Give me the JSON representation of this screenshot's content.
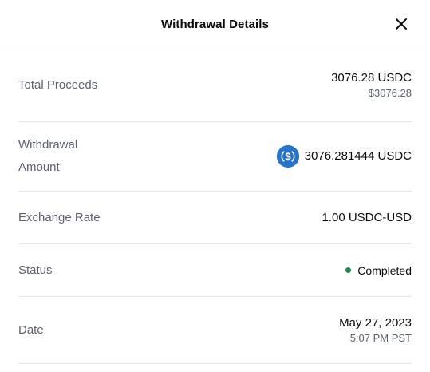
{
  "header": {
    "title": "Withdrawal Details",
    "close_icon": "close-icon"
  },
  "rows": {
    "total_proceeds": {
      "label": "Total Proceeds",
      "value": "3076.28 USDC",
      "sub_value": "$3076.28"
    },
    "withdrawal_amount": {
      "label_line1": "Withdrawal",
      "label_line2": "Amount",
      "value": "3076.281444 USDC",
      "icon": "usdc-coin-icon"
    },
    "exchange_rate": {
      "label": "Exchange Rate",
      "value": "1.00 USDC-USD"
    },
    "status": {
      "label": "Status",
      "value": "Completed",
      "color": "#1f8a56"
    },
    "date": {
      "label": "Date",
      "value": "May 27, 2023",
      "sub_value": "5:07 PM PST"
    }
  },
  "colors": {
    "usdc_blue": "#2775ca",
    "divider": "#e3e5e8",
    "label_gray": "#5b616e"
  }
}
